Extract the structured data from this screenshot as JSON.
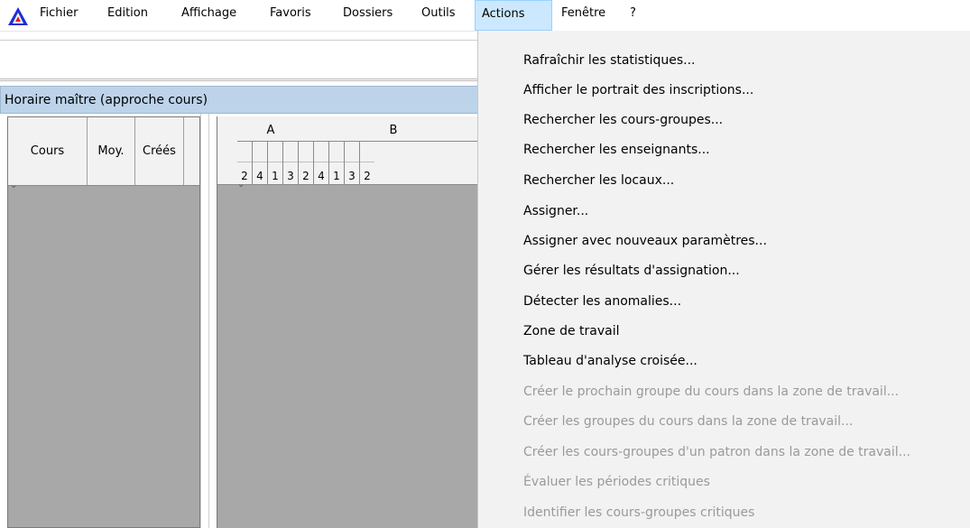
{
  "menubar": {
    "items": [
      {
        "label": "Fichier"
      },
      {
        "label": "Edition"
      },
      {
        "label": "Affichage"
      },
      {
        "label": "Favoris"
      },
      {
        "label": "Dossiers"
      },
      {
        "label": "Outils"
      },
      {
        "label": "Actions"
      },
      {
        "label": "Fenêtre"
      },
      {
        "label": "?"
      }
    ],
    "active": "Actions"
  },
  "window": {
    "title": "Horaire maître (approche cours)"
  },
  "left_table": {
    "columns": [
      "Cours",
      "Moy.",
      "Créés"
    ]
  },
  "right_table": {
    "groups": [
      "A",
      "B"
    ],
    "period_numbers": [
      "2",
      "4",
      "1",
      "3",
      "2",
      "4",
      "1",
      "3",
      "2"
    ]
  },
  "actions_menu": {
    "items": [
      {
        "label": "Rafraîchir les statistiques...",
        "enabled": true
      },
      {
        "label": "Afficher le portrait des inscriptions...",
        "enabled": true
      },
      {
        "label": "Rechercher les cours-groupes...",
        "enabled": true
      },
      {
        "label": "Rechercher les enseignants...",
        "enabled": true
      },
      {
        "label": "Rechercher les locaux...",
        "enabled": true
      },
      {
        "label": "Assigner...",
        "enabled": true
      },
      {
        "label": "Assigner avec nouveaux paramètres...",
        "enabled": true
      },
      {
        "label": "Gérer les résultats d'assignation...",
        "enabled": true
      },
      {
        "label": "Détecter les anomalies...",
        "enabled": true
      },
      {
        "label": "Zone de travail",
        "enabled": true
      },
      {
        "label": "Tableau d'analyse croisée...",
        "enabled": true
      },
      {
        "label": "Créer le prochain groupe du cours dans la zone de travail...",
        "enabled": false
      },
      {
        "label": "Créer les groupes du cours dans la zone de travail...",
        "enabled": false
      },
      {
        "label": "Créer les cours-groupes d'un patron dans la zone de travail...",
        "enabled": false
      },
      {
        "label": "Évaluer les périodes critiques",
        "enabled": false
      },
      {
        "label": "Identifier les cours-groupes critiques",
        "enabled": false
      }
    ]
  },
  "colors": {
    "menu_highlight": "#cce8ff",
    "title_bar": "#bcd3ea",
    "grid_background": "#a8a8a8",
    "dropdown_background": "#f2f2f2",
    "disabled_text": "#9a9a9a"
  }
}
